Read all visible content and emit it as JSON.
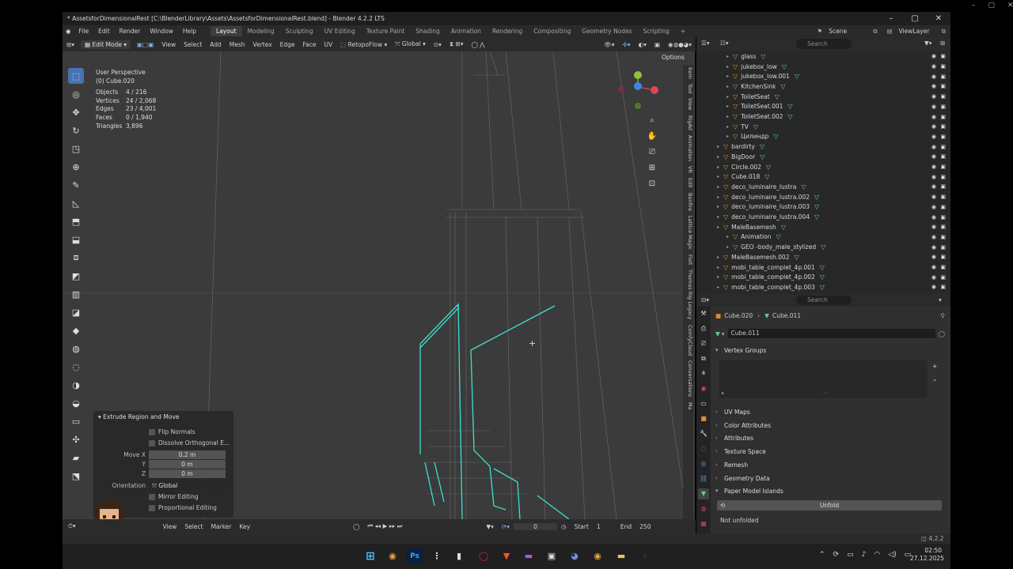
{
  "window": {
    "title": "* AssetsforDimensionalRest [C:\\BlenderLibrary\\Assets\\AssetsforDimensionalRest.blend] - Blender 4.2.2 LTS"
  },
  "menu": [
    "File",
    "Edit",
    "Render",
    "Window",
    "Help"
  ],
  "workspaces": [
    "Layout",
    "Modeling",
    "Sculpting",
    "UV Editing",
    "Texture Paint",
    "Shading",
    "Animation",
    "Rendering",
    "Compositing",
    "Geometry Nodes",
    "Scripting"
  ],
  "active_workspace": "Layout",
  "scene": "Scene",
  "view_layer": "ViewLayer",
  "viewport_header": {
    "mode": "Edit Mode",
    "items": [
      "View",
      "Select",
      "Add",
      "Mesh",
      "Vertex",
      "Edge",
      "Face",
      "UV"
    ],
    "addon": "RetopoFlow",
    "orientation": "Global",
    "options": "Options"
  },
  "overlay": {
    "view": "User Perspective",
    "object": "(0) Cube.020",
    "stats": [
      {
        "k": "Objects",
        "v": "4 / 216"
      },
      {
        "k": "Vertices",
        "v": "24 / 2,068"
      },
      {
        "k": "Edges",
        "v": "23 / 4,001"
      },
      {
        "k": "Faces",
        "v": "0 / 1,940"
      },
      {
        "k": "Triangles",
        "v": "3,896"
      }
    ]
  },
  "operator_panel": {
    "title": "Extrude Region and Move",
    "flip_normals": "Flip Normals",
    "dissolve": "Dissolve Orthogonal E...",
    "move_label": "Move X",
    "y_label": "Y",
    "z_label": "Z",
    "move_x": "0.2 m",
    "move_y": "0 m",
    "move_z": "0 m",
    "orientation_label": "Orientation",
    "orientation": "Global",
    "mirror": "Mirror Editing",
    "proportional": "Proportional Editing"
  },
  "side_tabs": [
    "Item",
    "Tool",
    "View",
    "RigAd",
    "Animation",
    "VR",
    "Edit",
    "Bonfire",
    "Lattice Magic",
    "FixIt",
    "Thomas Rig Legacy",
    "ComfyCloud",
    "Conversations",
    "Ma"
  ],
  "timeline": {
    "items": [
      "View",
      "Select",
      "Marker",
      "Key"
    ],
    "current_frame": "0",
    "start_label": "Start",
    "start": "1",
    "end_label": "End",
    "end": "250"
  },
  "outliner": {
    "search_placeholder": "Search",
    "items": [
      {
        "name": "glass",
        "indent": 2
      },
      {
        "name": "jukebox_low",
        "indent": 2
      },
      {
        "name": "jukebox_low.001",
        "indent": 2
      },
      {
        "name": "KitchenSink",
        "indent": 2
      },
      {
        "name": "ToiletSeat",
        "indent": 2
      },
      {
        "name": "ToiletSeat.001",
        "indent": 2
      },
      {
        "name": "ToiletSeat.002",
        "indent": 2
      },
      {
        "name": "TV",
        "indent": 2
      },
      {
        "name": "Цилиндр",
        "indent": 2
      },
      {
        "name": "bardirty",
        "indent": 1
      },
      {
        "name": "BigDoor",
        "indent": 1
      },
      {
        "name": "Circle.002",
        "indent": 1
      },
      {
        "name": "Cube.018",
        "indent": 1
      },
      {
        "name": "deco_luminaire_lustra",
        "indent": 1
      },
      {
        "name": "deco_luminaire_lustra.002",
        "indent": 1
      },
      {
        "name": "deco_luminaire_lustra.003",
        "indent": 1
      },
      {
        "name": "deco_luminaire_lustra.004",
        "indent": 1
      },
      {
        "name": "MaleBasemesh",
        "indent": 1
      },
      {
        "name": "Animation",
        "indent": 2
      },
      {
        "name": "GEO -body_male_stylized",
        "indent": 2
      },
      {
        "name": "MaleBasemesh.002",
        "indent": 1
      },
      {
        "name": "mobi_table_complet_4p.001",
        "indent": 1
      },
      {
        "name": "mobi_table_complet_4p.002",
        "indent": 1
      },
      {
        "name": "mobi_table_complet_4p.003",
        "indent": 1
      }
    ]
  },
  "properties": {
    "search_placeholder": "Search",
    "breadcrumb_obj": "Cube.020",
    "breadcrumb_mesh": "Cube.011",
    "mesh_name": "Cube.011",
    "sections": [
      "Vertex Groups",
      "UV Maps",
      "Color Attributes",
      "Attributes",
      "Texture Space",
      "Remesh",
      "Geometry Data",
      "Paper Model Islands"
    ],
    "unfold_button": "Unfold",
    "status": "Not unfolded"
  },
  "tray": {
    "time": "02:50",
    "date": "27.12.2025"
  },
  "colors": {
    "accent": "#4772b3",
    "selection": "#3de0d0",
    "object_icon": "#e08a2e",
    "mesh_icon": "#5fd38b"
  }
}
